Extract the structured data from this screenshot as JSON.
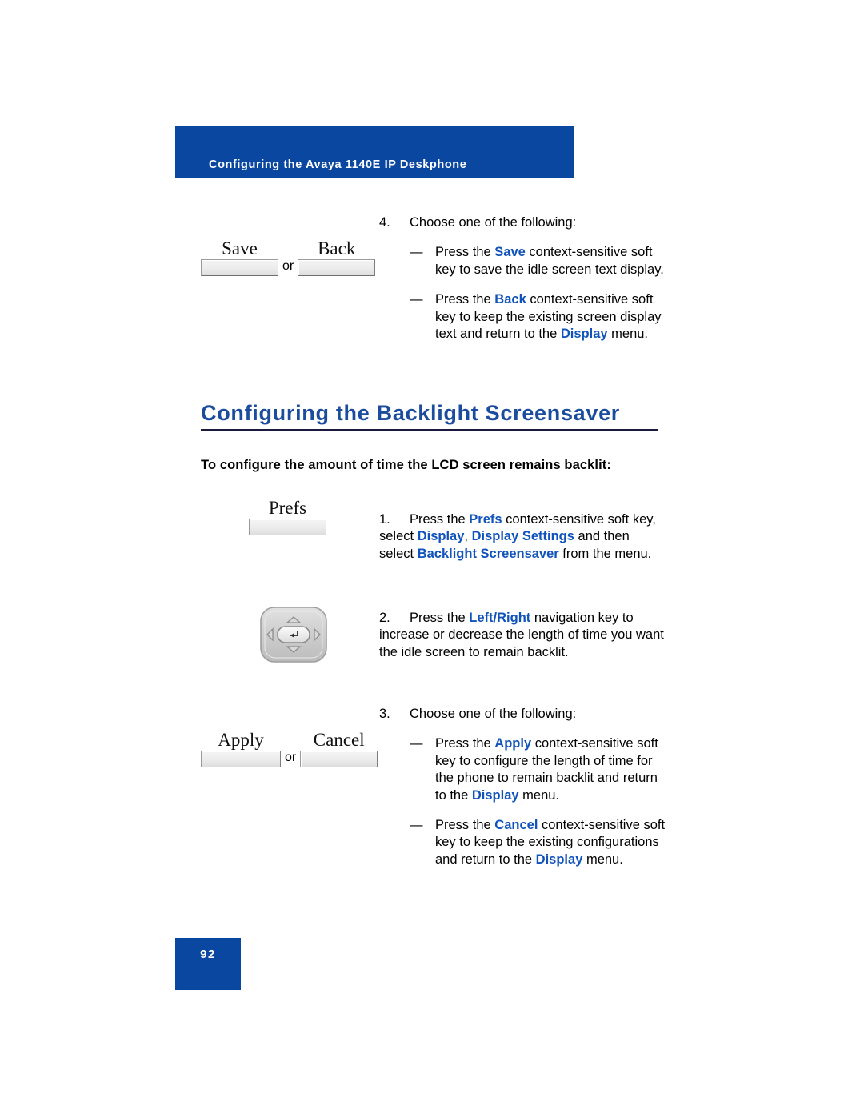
{
  "header": {
    "title": "Configuring the Avaya 1140E IP Deskphone",
    "bg_color": "#0a47a0",
    "text_color": "#ffffff"
  },
  "colors": {
    "accent_blue": "#0a47a0",
    "keyword_blue": "#1053ba",
    "heading_blue": "#1b4c9e",
    "rule_dark": "#1a1a3c",
    "page_background": "#ffffff"
  },
  "step4": {
    "number": "4.",
    "lead": "Choose one of the following:",
    "softkeys": {
      "first_label": "Save",
      "conjunction": "or",
      "second_label": "Back"
    },
    "bullets": [
      {
        "dash": "—",
        "parts": [
          {
            "text": "Press the ",
            "style": "normal"
          },
          {
            "text": "Save",
            "style": "keyword"
          },
          {
            "text": " context-sensitive soft key to save the idle screen text display.",
            "style": "normal"
          }
        ]
      },
      {
        "dash": "—",
        "parts": [
          {
            "text": "Press the ",
            "style": "normal"
          },
          {
            "text": "Back",
            "style": "keyword"
          },
          {
            "text": " context-sensitive soft key to keep the existing screen display text and return to the ",
            "style": "normal"
          },
          {
            "text": "Display",
            "style": "keyword"
          },
          {
            "text": " menu.",
            "style": "normal"
          }
        ]
      }
    ]
  },
  "section": {
    "heading": "Configuring the Backlight Screensaver",
    "intro": "To configure the amount of time the LCD screen remains backlit:"
  },
  "step1": {
    "number": "1.",
    "softkey_label": "Prefs",
    "parts": [
      {
        "text": "Press the ",
        "style": "normal"
      },
      {
        "text": "Prefs",
        "style": "keyword"
      },
      {
        "text": " context-sensitive soft key, select ",
        "style": "normal"
      },
      {
        "text": "Display",
        "style": "keyword"
      },
      {
        "text": ", ",
        "style": "normal"
      },
      {
        "text": "Display Settings",
        "style": "keyword"
      },
      {
        "text": " and then select ",
        "style": "normal"
      },
      {
        "text": "Backlight Screensaver",
        "style": "keyword"
      },
      {
        "text": " from the menu.",
        "style": "normal"
      }
    ]
  },
  "step2": {
    "number": "2.",
    "icon": "navigation-key",
    "parts": [
      {
        "text": "Press the ",
        "style": "normal"
      },
      {
        "text": "Left/Right",
        "style": "keyword"
      },
      {
        "text": " navigation key to increase or decrease the length of time you want the idle screen to remain backlit.",
        "style": "normal"
      }
    ]
  },
  "step3": {
    "number": "3.",
    "lead": "Choose one of the following:",
    "softkeys": {
      "first_label": "Apply",
      "conjunction": "or",
      "second_label": "Cancel"
    },
    "bullets": [
      {
        "dash": "—",
        "parts": [
          {
            "text": "Press the ",
            "style": "normal"
          },
          {
            "text": "Apply",
            "style": "keyword"
          },
          {
            "text": " context-sensitive soft key to configure the length of time for the phone to remain backlit and return to the ",
            "style": "normal"
          },
          {
            "text": "Display",
            "style": "keyword"
          },
          {
            "text": " menu.",
            "style": "normal"
          }
        ]
      },
      {
        "dash": "—",
        "parts": [
          {
            "text": "Press the ",
            "style": "normal"
          },
          {
            "text": "Cancel",
            "style": "keyword"
          },
          {
            "text": " context-sensitive soft key to keep the existing configurations and return to the ",
            "style": "normal"
          },
          {
            "text": "Display",
            "style": "keyword"
          },
          {
            "text": " menu.",
            "style": "normal"
          }
        ]
      }
    ]
  },
  "footer": {
    "page_number": "92"
  }
}
